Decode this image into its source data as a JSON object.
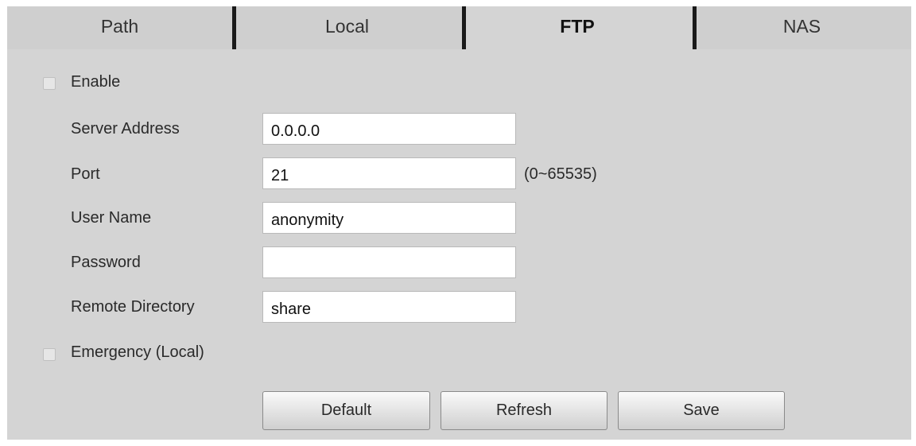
{
  "tabs": [
    {
      "label": "Path",
      "active": false
    },
    {
      "label": "Local",
      "active": false
    },
    {
      "label": "FTP",
      "active": true
    },
    {
      "label": "NAS",
      "active": false
    }
  ],
  "form": {
    "enable": {
      "label": "Enable",
      "checked": false
    },
    "server_address": {
      "label": "Server Address",
      "value": "0.0.0.0"
    },
    "port": {
      "label": "Port",
      "value": "21",
      "range_hint": "(0~65535)"
    },
    "user_name": {
      "label": "User Name",
      "value": "anonymity"
    },
    "password": {
      "label": "Password",
      "value": ""
    },
    "remote_directory": {
      "label": "Remote Directory",
      "value": "share"
    },
    "emergency": {
      "label": "Emergency (Local)",
      "checked": false
    }
  },
  "buttons": {
    "default_label": "Default",
    "refresh_label": "Refresh",
    "save_label": "Save"
  },
  "colors": {
    "panel_background": "#d4d4d4",
    "tab_separator": "#1a1a1a"
  }
}
